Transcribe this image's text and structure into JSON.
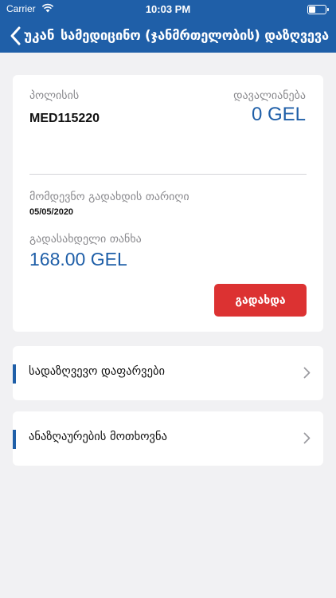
{
  "status_bar": {
    "carrier": "Carrier",
    "time": "10:03 PM"
  },
  "nav": {
    "back_label": "უკან",
    "title": "სამედიცინო (ჯანმრთელობის) დაზღვევა"
  },
  "policy_card": {
    "policy_label": "პოლისის",
    "policy_number": "MED115220",
    "debt_label": "დავალიანება",
    "debt_value": "0 GEL",
    "next_payment_label": "მომდევნო გადახდის თარიღი",
    "next_payment_date": "05/05/2020",
    "amount_label": "გადასახდელი თანხა",
    "amount_value": "168.00 GEL",
    "pay_button": "გადახდა"
  },
  "menu_rows": [
    {
      "label": "სადაზღვევო დაფარვები"
    },
    {
      "label": "ანაზღაურების მოთხოვნა"
    }
  ],
  "colors": {
    "brand_blue": "#1f5fa8",
    "pay_red": "#dc3232",
    "background": "#f1f1f3"
  },
  "icons": [
    "wifi-icon",
    "battery-icon",
    "back-chevron-icon",
    "chevron-right-icon"
  ]
}
